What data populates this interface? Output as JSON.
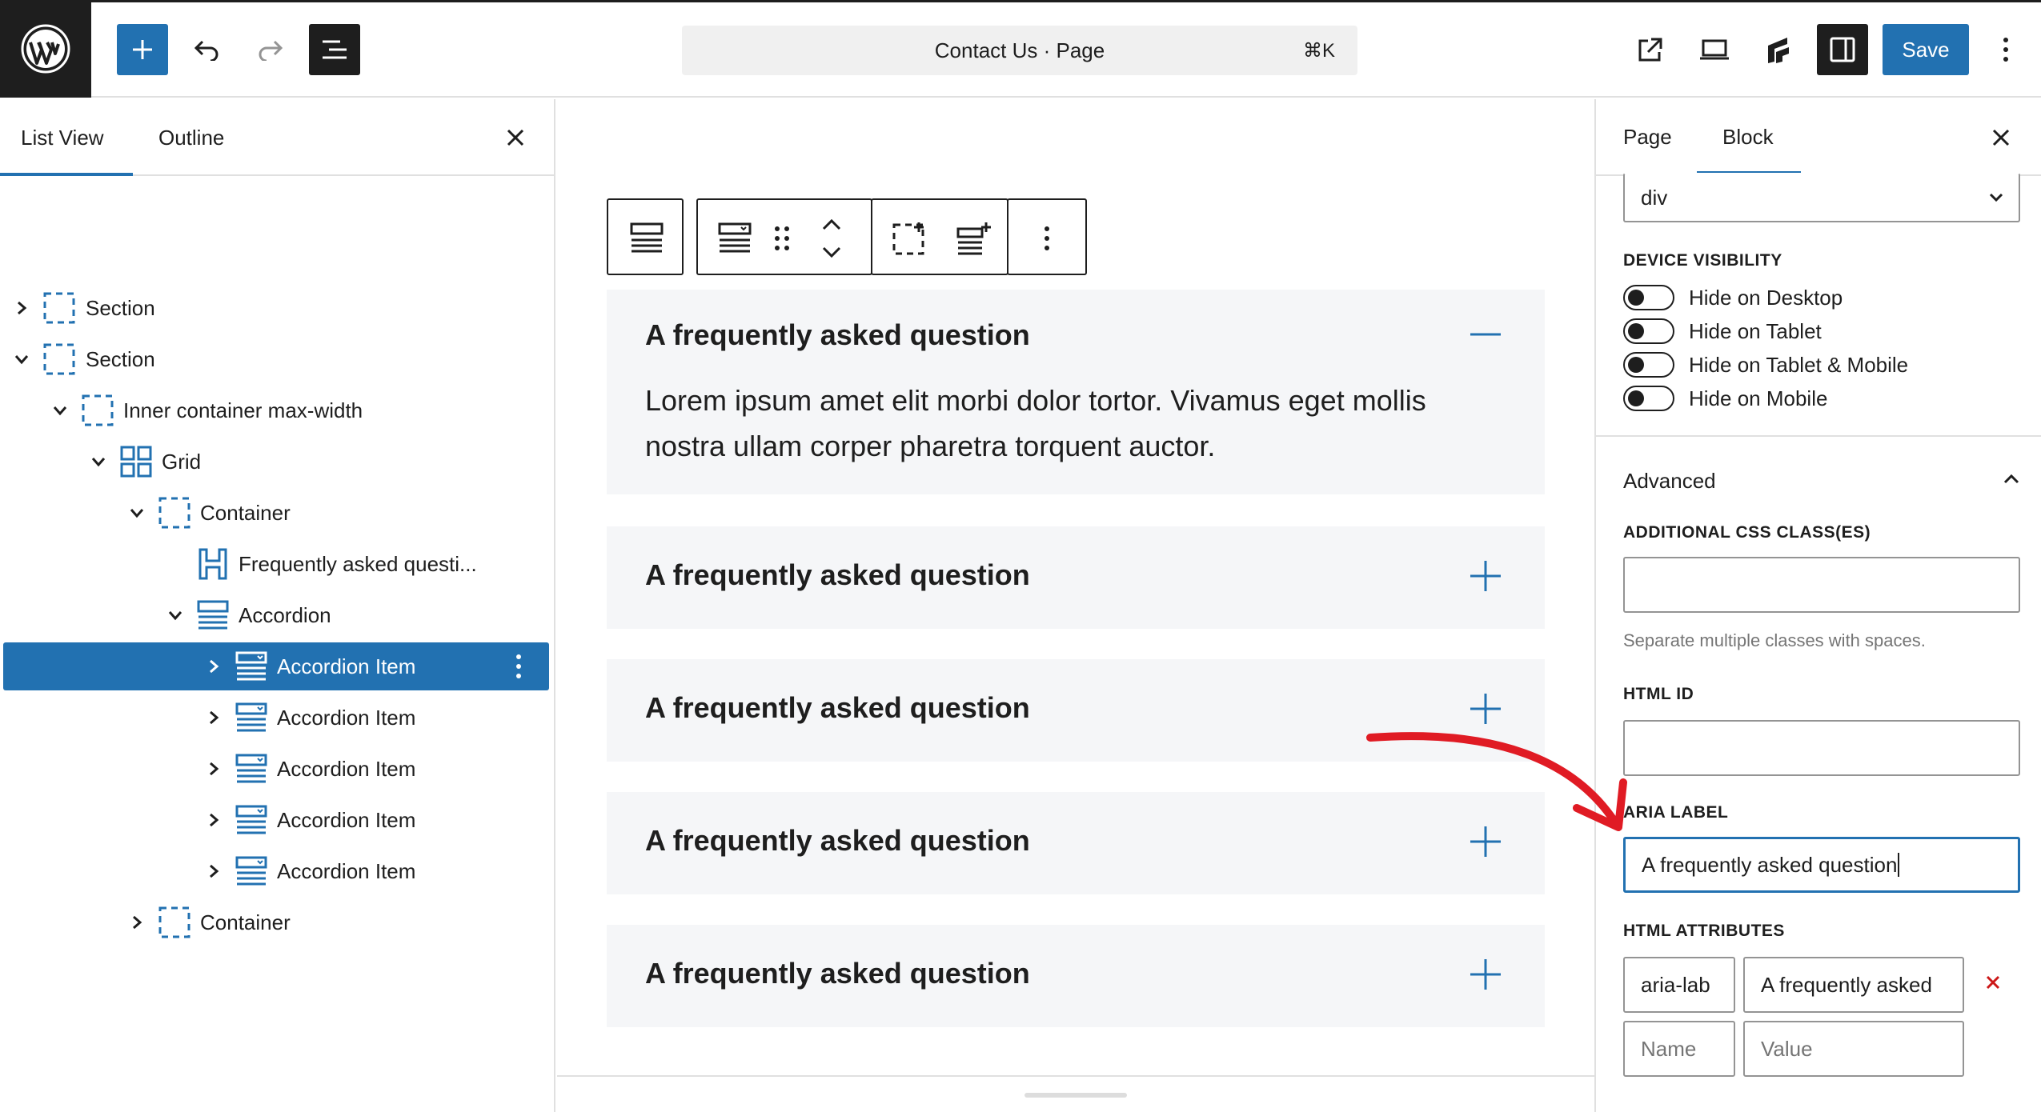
{
  "header": {
    "doc_title": "Contact Us · Page",
    "shortcut": "⌘K",
    "save_label": "Save"
  },
  "left_panel": {
    "tabs": [
      "List View",
      "Outline"
    ],
    "tree": [
      {
        "label": "Section"
      },
      {
        "label": "Section"
      },
      {
        "label": "Inner container max-width"
      },
      {
        "label": "Grid"
      },
      {
        "label": "Container"
      },
      {
        "label": "Frequently asked questi..."
      },
      {
        "label": "Accordion"
      },
      {
        "label": "Accordion Item"
      },
      {
        "label": "Accordion Item"
      },
      {
        "label": "Accordion Item"
      },
      {
        "label": "Accordion Item"
      },
      {
        "label": "Accordion Item"
      },
      {
        "label": "Container"
      }
    ]
  },
  "canvas": {
    "accordion": [
      {
        "question": "A frequently asked question",
        "answer": "Lorem ipsum amet elit morbi dolor tortor. Vivamus eget mollis nostra ullam corper pharetra torquent auctor.",
        "expanded": true
      },
      {
        "question": "A frequently asked question",
        "expanded": false
      },
      {
        "question": "A frequently asked question",
        "expanded": false
      },
      {
        "question": "A frequently asked question",
        "expanded": false
      },
      {
        "question": "A frequently asked question",
        "expanded": false
      }
    ]
  },
  "right_panel": {
    "tabs": [
      "Page",
      "Block"
    ],
    "tag_select": "div",
    "device_visibility": {
      "heading": "DEVICE VISIBILITY",
      "options": [
        "Hide on Desktop",
        "Hide on Tablet",
        "Hide on Tablet & Mobile",
        "Hide on Mobile"
      ]
    },
    "advanced": {
      "heading": "Advanced",
      "css_label": "ADDITIONAL CSS CLASS(ES)",
      "css_help": "Separate multiple classes with spaces.",
      "html_id_label": "HTML ID",
      "aria_label": "ARIA LABEL",
      "aria_value": "A frequently asked question",
      "html_attr_label": "HTML ATTRIBUTES",
      "attr_name": "aria-lab",
      "attr_value": "A frequently asked",
      "name_placeholder": "Name",
      "value_placeholder": "Value"
    }
  },
  "colors": {
    "accent": "#2271b1",
    "dark": "#1e1e1e",
    "annotation_arrow": "#e01b24",
    "remove_icon": "#cc1818"
  }
}
